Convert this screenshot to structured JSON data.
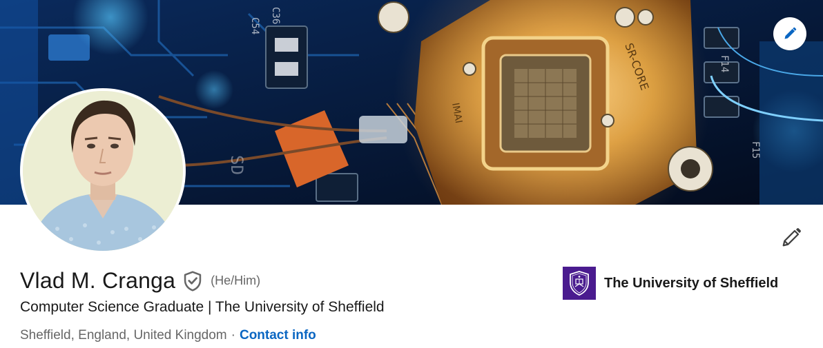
{
  "profile": {
    "name": "Vlad M. Cranga",
    "pronouns": "(He/Him)",
    "headline": "Computer Science Graduate | The University of Sheffield",
    "location": "Sheffield, England, United Kingdom",
    "separator": "·",
    "contact_label": "Contact info"
  },
  "banner": {
    "markings": {
      "sr_core": "SR-CORE",
      "c36": "C36",
      "c54": "C54",
      "f14": "F14",
      "f15": "F15",
      "imai": "IMAI",
      "sd": "SD"
    }
  },
  "education": {
    "school": "The University of Sheffield"
  },
  "icons": {
    "banner_edit": "pencil-icon",
    "intro_edit": "pencil-icon",
    "verified": "shield-check-icon",
    "school_logo": "university-crest-icon"
  },
  "colors": {
    "link": "#0a66c2",
    "text_primary": "#191919",
    "text_secondary": "#666666",
    "edu_logo_bg": "#4a1b8f",
    "banner_edit_icon": "#0a66c2"
  }
}
